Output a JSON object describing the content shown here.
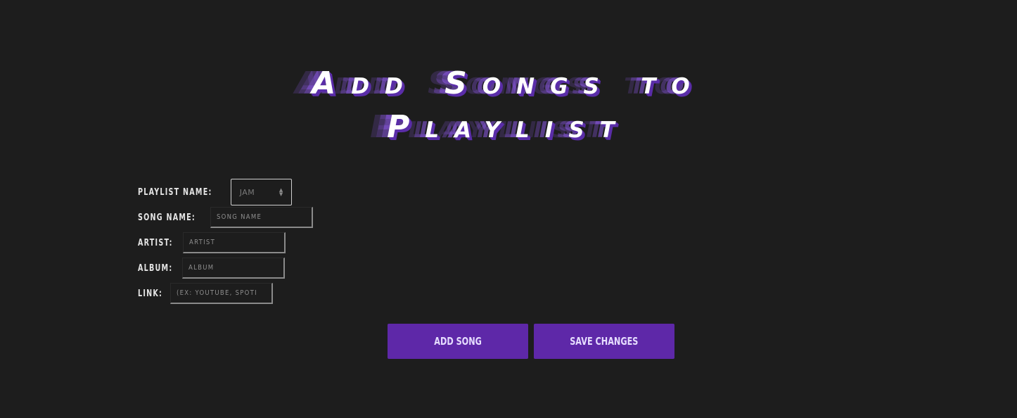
{
  "title": {
    "line1": "Add Songs to",
    "line2": "Playlist"
  },
  "form": {
    "playlist_name": {
      "label": "PLAYLIST NAME:",
      "selected": "JAM"
    },
    "song_name": {
      "label": "SONG NAME:",
      "placeholder": "SONG NAME"
    },
    "artist": {
      "label": "ARTIST:",
      "placeholder": "ARTIST"
    },
    "album": {
      "label": "ALBUM:",
      "placeholder": "ALBUM"
    },
    "link": {
      "label": "LINK:",
      "placeholder": "(EX: YOUTUBE, SPOTI"
    }
  },
  "buttons": {
    "add_song": "ADD SONG",
    "save_changes": "SAVE CHANGES"
  },
  "colors": {
    "background": "#1d1d1d",
    "accent": "#5e28a8",
    "title_shadow": "#5a2da8"
  },
  "icons": {
    "select_arrows": "up-down-chevron-icon"
  }
}
